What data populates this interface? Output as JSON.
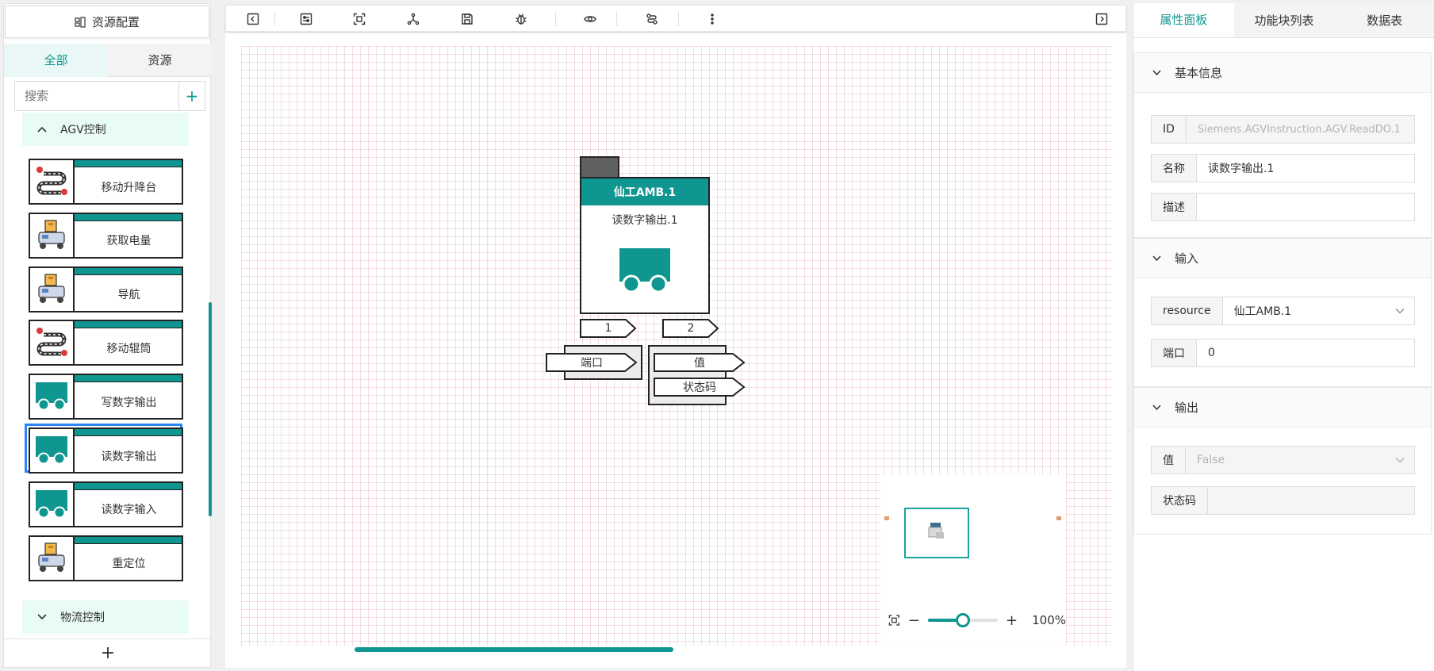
{
  "left": {
    "resource_config": "资源配置",
    "tabs": [
      "全部",
      "资源"
    ],
    "search_placeholder": "搜索",
    "add_symbol": "+",
    "group_agv": "AGV控制",
    "group_logistics": "物流控制",
    "items": [
      {
        "label": "移动升降台",
        "icon": "route-icon"
      },
      {
        "label": "获取电量",
        "icon": "agv-robot-icon"
      },
      {
        "label": "导航",
        "icon": "agv-robot-icon"
      },
      {
        "label": "移动辊筒",
        "icon": "route-icon"
      },
      {
        "label": "写数字输出",
        "icon": "truck-icon"
      },
      {
        "label": "读数字输出",
        "icon": "truck-icon",
        "selected": true
      },
      {
        "label": "读数字输入",
        "icon": "truck-icon"
      },
      {
        "label": "重定位",
        "icon": "agv-robot-icon"
      }
    ],
    "bottom_add": "+"
  },
  "toolbar": {
    "buttons": [
      "collapse-left-icon",
      "sliders-icon",
      "fit-view-icon",
      "graph-icon",
      "save-icon",
      "debug-icon",
      "preview-icon",
      "flow-icon",
      "more-icon",
      "collapse-right-icon"
    ]
  },
  "canvas": {
    "node": {
      "resource": "仙工AMB.1",
      "instance": "读数字输出.1",
      "port_1": "1",
      "port_2": "2",
      "input": "端口",
      "output_value": "值",
      "output_status": "状态码"
    },
    "zoom": "100%",
    "zoom_level": 0.5,
    "zoom_minus": "−",
    "zoom_plus": "+"
  },
  "right": {
    "tabs": [
      "属性面板",
      "功能块列表",
      "数据表"
    ],
    "basic": {
      "title": "基本信息",
      "id_label": "ID",
      "id_value": "Siemens.AGVInstruction.AGV.ReadDO.1",
      "name_label": "名称",
      "name_value": "读数字输出.1",
      "desc_label": "描述",
      "desc_value": ""
    },
    "input": {
      "title": "输入",
      "resource_label": "resource",
      "resource_value": "仙工AMB.1",
      "port_label": "端口",
      "port_value": "0"
    },
    "output": {
      "title": "输出",
      "value_label": "值",
      "value_value": "False",
      "status_label": "状态码",
      "status_value": ""
    }
  },
  "colors": {
    "accent": "#0f9690",
    "selected_border": "#2a86f5",
    "group_bg": "#e8fbf7"
  }
}
